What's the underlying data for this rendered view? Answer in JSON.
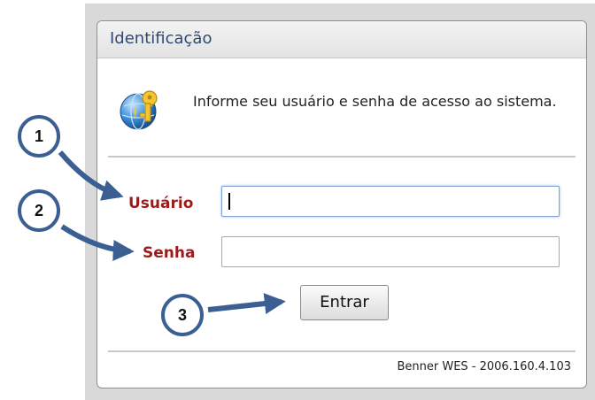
{
  "panel": {
    "title": "Identificação",
    "info_text": "Informe seu usuário e senha de acesso ao sistema.",
    "icon": "key-globe-icon"
  },
  "form": {
    "user_label": "Usuário",
    "user_value": "",
    "password_label": "Senha",
    "password_value": "",
    "submit_label": "Entrar"
  },
  "footer": {
    "version": "Benner WES - 2006.160.4.103"
  },
  "callouts": [
    "1",
    "2",
    "3"
  ],
  "colors": {
    "label": "#9b1c1c",
    "title": "#2f4a72",
    "callout_fill": "#ffffff",
    "callout_stroke": "#3b5f92",
    "arrow": "#3b5f92"
  }
}
